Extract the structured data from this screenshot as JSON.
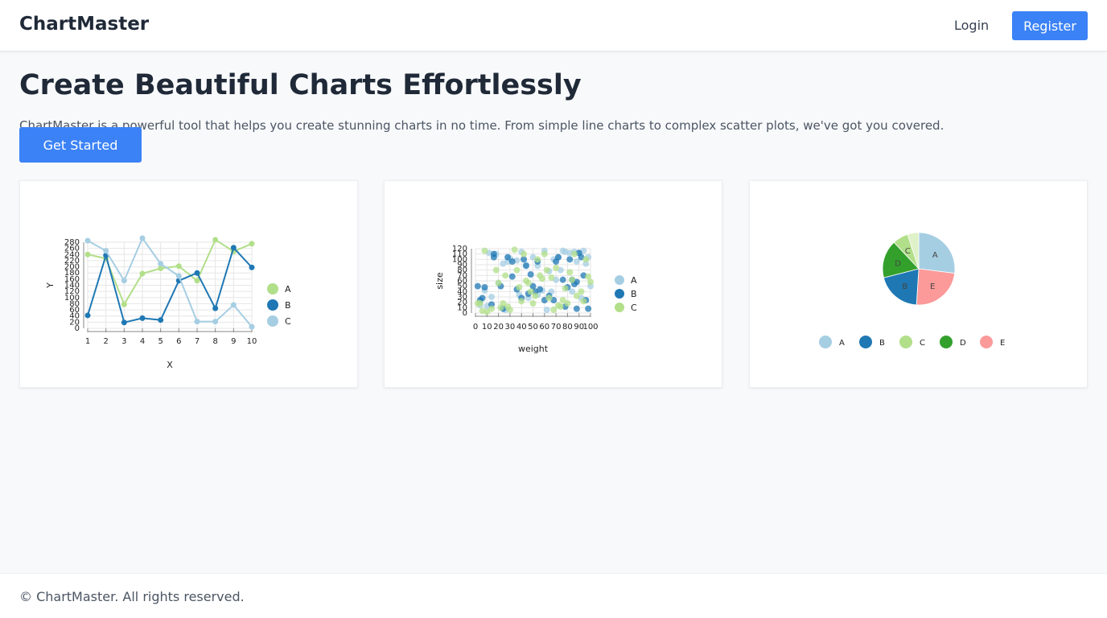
{
  "header": {
    "brand": "ChartMaster",
    "login_label": "Login",
    "register_label": "Register"
  },
  "hero": {
    "title": "Create Beautiful Charts Effortlessly",
    "description": "ChartMaster is a powerful tool that helps you create stunning charts in no time. From simple line charts to complex scatter plots, we've got you covered.",
    "cta_label": "Get Started"
  },
  "footer": {
    "copyright": "© ChartMaster. All rights reserved."
  },
  "colors": {
    "accent": "#3b82f6",
    "A": "#a6cee3",
    "B": "#1f78b4",
    "C": "#b2df8a",
    "D": "#33a02c",
    "E": "#fb9a99",
    "lineA": "#b2df8a",
    "lineB": "#1f78b4",
    "lineC": "#a6cee3"
  },
  "chart_data": [
    {
      "type": "line",
      "xlabel": "X",
      "ylabel": "Y",
      "x": [
        1,
        2,
        3,
        4,
        5,
        6,
        7,
        8,
        9,
        10
      ],
      "xlim": [
        1,
        10
      ],
      "ylim": [
        0,
        280
      ],
      "yticks": [
        0,
        20,
        40,
        60,
        80,
        100,
        120,
        140,
        160,
        180,
        200,
        220,
        240,
        260,
        280
      ],
      "grid": true,
      "legend": "right",
      "series": [
        {
          "name": "A",
          "values": [
            240,
            227,
            78,
            178,
            195,
            202,
            155,
            288,
            250,
            275
          ]
        },
        {
          "name": "B",
          "values": [
            42,
            237,
            19,
            33,
            27,
            155,
            180,
            65,
            262,
            198
          ]
        },
        {
          "name": "C",
          "values": [
            285,
            252,
            155,
            293,
            210,
            170,
            22,
            22,
            76,
            5
          ]
        }
      ]
    },
    {
      "type": "scatter",
      "xlabel": "weight",
      "ylabel": "size",
      "xlim": [
        0,
        100
      ],
      "ylim": [
        0,
        120
      ],
      "xticks": [
        0,
        10,
        20,
        30,
        40,
        50,
        60,
        70,
        80,
        90,
        100
      ],
      "yticks": [
        0,
        10,
        20,
        30,
        40,
        50,
        60,
        70,
        80,
        90,
        100,
        110,
        120
      ],
      "grid": true,
      "legend": "right",
      "series": [
        {
          "name": "A",
          "points": [
            [
              4,
              15
            ],
            [
              10,
              13
            ],
            [
              12,
              112
            ],
            [
              18,
              110
            ],
            [
              24,
              92
            ],
            [
              28,
              96
            ],
            [
              30,
              102
            ],
            [
              36,
              98
            ],
            [
              40,
              114
            ],
            [
              44,
              90
            ],
            [
              50,
              104
            ],
            [
              54,
              88
            ],
            [
              58,
              42
            ],
            [
              60,
              116
            ],
            [
              64,
              78
            ],
            [
              68,
              100
            ],
            [
              72,
              104
            ],
            [
              76,
              116
            ],
            [
              78,
              114
            ],
            [
              82,
              112
            ],
            [
              86,
              114
            ],
            [
              90,
              112
            ],
            [
              94,
              116
            ],
            [
              98,
              104
            ],
            [
              100,
              50
            ],
            [
              96,
              92
            ],
            [
              88,
              96
            ],
            [
              74,
              80
            ],
            [
              62,
              6
            ],
            [
              54,
              34
            ],
            [
              46,
              28
            ],
            [
              38,
              34
            ],
            [
              20,
              56
            ],
            [
              8,
              42
            ],
            [
              14,
              30
            ],
            [
              66,
              40
            ],
            [
              70,
              62
            ],
            [
              84,
              40
            ],
            [
              92,
              28
            ],
            [
              26,
              6
            ]
          ]
        },
        {
          "name": "B",
          "points": [
            [
              2,
              50
            ],
            [
              4,
              24
            ],
            [
              6,
              28
            ],
            [
              8,
              48
            ],
            [
              14,
              16
            ],
            [
              16,
              110
            ],
            [
              16,
              104
            ],
            [
              22,
              50
            ],
            [
              24,
              8
            ],
            [
              28,
              104
            ],
            [
              32,
              68
            ],
            [
              32,
              96
            ],
            [
              36,
              44
            ],
            [
              40,
              28
            ],
            [
              42,
              100
            ],
            [
              44,
              88
            ],
            [
              46,
              36
            ],
            [
              48,
              72
            ],
            [
              50,
              50
            ],
            [
              52,
              40
            ],
            [
              54,
              96
            ],
            [
              56,
              44
            ],
            [
              60,
              24
            ],
            [
              64,
              32
            ],
            [
              68,
              24
            ],
            [
              70,
              96
            ],
            [
              72,
              104
            ],
            [
              76,
              62
            ],
            [
              78,
              12
            ],
            [
              80,
              48
            ],
            [
              82,
              100
            ],
            [
              84,
              62
            ],
            [
              88,
              58
            ],
            [
              90,
              112
            ],
            [
              92,
              104
            ],
            [
              94,
              70
            ],
            [
              96,
              24
            ],
            [
              98,
              8
            ],
            [
              88,
              8
            ],
            [
              86,
              54
            ]
          ]
        },
        {
          "name": "C",
          "points": [
            [
              2,
              18
            ],
            [
              4,
              18
            ],
            [
              6,
              4
            ],
            [
              8,
              116
            ],
            [
              10,
              2
            ],
            [
              14,
              8
            ],
            [
              18,
              80
            ],
            [
              20,
              56
            ],
            [
              22,
              10
            ],
            [
              24,
              18
            ],
            [
              26,
              70
            ],
            [
              28,
              12
            ],
            [
              30,
              6
            ],
            [
              34,
              118
            ],
            [
              36,
              80
            ],
            [
              38,
              48
            ],
            [
              40,
              22
            ],
            [
              42,
              110
            ],
            [
              44,
              60
            ],
            [
              46,
              56
            ],
            [
              48,
              40
            ],
            [
              50,
              18
            ],
            [
              52,
              32
            ],
            [
              54,
              100
            ],
            [
              56,
              70
            ],
            [
              58,
              64
            ],
            [
              60,
              110
            ],
            [
              62,
              80
            ],
            [
              64,
              28
            ],
            [
              66,
              66
            ],
            [
              68,
              6
            ],
            [
              70,
              84
            ],
            [
              72,
              14
            ],
            [
              74,
              12
            ],
            [
              76,
              24
            ],
            [
              78,
              46
            ],
            [
              80,
              18
            ],
            [
              82,
              76
            ],
            [
              84,
              62
            ],
            [
              86,
              110
            ],
            [
              88,
              32
            ],
            [
              92,
              40
            ],
            [
              94,
              22
            ],
            [
              96,
              100
            ],
            [
              98,
              68
            ],
            [
              100,
              58
            ]
          ]
        }
      ]
    },
    {
      "type": "pie",
      "legend": "bottom",
      "slices": [
        {
          "label": "A",
          "value": 27
        },
        {
          "label": "E",
          "value": 24
        },
        {
          "label": "B",
          "value": 20
        },
        {
          "label": "D",
          "value": 17
        },
        {
          "label": "C",
          "value": 7
        },
        {
          "label": "",
          "value": 5
        }
      ],
      "legend_items": [
        "A",
        "B",
        "C",
        "D",
        "E"
      ]
    }
  ]
}
